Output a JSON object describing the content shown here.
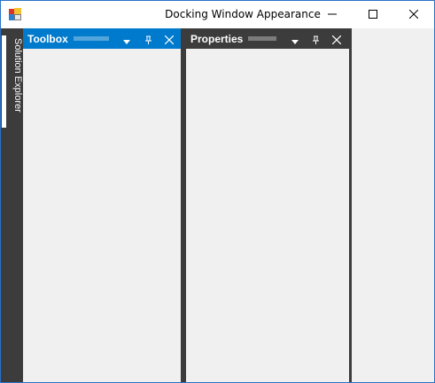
{
  "window": {
    "title": "Docking Window Appearance",
    "icon": "application-icon",
    "controls": {
      "minimize": "minimize-icon",
      "maximize": "maximize-icon",
      "close": "close-icon"
    }
  },
  "auto_hidden_tab": {
    "label": "Solution Explorer",
    "side": "left"
  },
  "panels": [
    {
      "title": "Toolbox",
      "state": "active",
      "header_color": "#007acc",
      "buttons": [
        "dropdown-arrow-icon",
        "pin-icon",
        "close-icon"
      ]
    },
    {
      "title": "Properties",
      "state": "inactive",
      "header_color": "#3c3c3c",
      "buttons": [
        "dropdown-arrow-icon",
        "pin-icon",
        "close-icon"
      ]
    }
  ],
  "colors": {
    "dock_dark": "#3c3c3c",
    "active_accent": "#007acc",
    "content_bg": "#f0f0f0",
    "window_border": "#2b72c7"
  }
}
